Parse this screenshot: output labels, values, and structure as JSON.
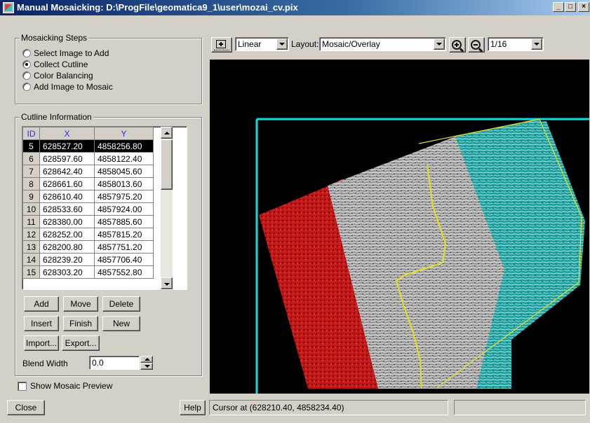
{
  "window": {
    "title": "Manual Mosaicking: D:\\ProgFile\\geomatica9_1\\user\\mozai_cv.pix",
    "controls": {
      "minimize": "_",
      "maximize": "□",
      "close": "×"
    }
  },
  "mosaicking_steps": {
    "label": "Mosaicking Steps",
    "options": [
      "Select Image to Add",
      "Collect Cutline",
      "Color Balancing",
      "Add Image to Mosaic"
    ],
    "selected_index": 1
  },
  "cutline": {
    "label": "Cutline Information",
    "columns": [
      "ID",
      "X",
      "Y"
    ],
    "rows": [
      [
        "5",
        "628527.20",
        "4858256.80"
      ],
      [
        "6",
        "628597.60",
        "4858122.40"
      ],
      [
        "7",
        "628642.40",
        "4858045.60"
      ],
      [
        "8",
        "628661.60",
        "4858013.60"
      ],
      [
        "9",
        "628610.40",
        "4857975.20"
      ],
      [
        "10",
        "628533.60",
        "4857924.00"
      ],
      [
        "11",
        "628380.00",
        "4857885.60"
      ],
      [
        "12",
        "628252.00",
        "4857815.20"
      ],
      [
        "13",
        "628200.80",
        "4857751.20"
      ],
      [
        "14",
        "628239.20",
        "4857706.40"
      ],
      [
        "15",
        "628303.20",
        "4857552.80"
      ]
    ],
    "selected_row": 0,
    "buttons": {
      "add": "Add",
      "move": "Move",
      "delete": "Delete",
      "insert": "Insert",
      "finish": "Finish",
      "new": "New",
      "import": "Import...",
      "export": "Export..."
    },
    "blend_width_label": "Blend Width",
    "blend_width_value": "0.0"
  },
  "show_preview_label": "Show Mosaic Preview",
  "show_preview_checked": false,
  "toolbar": {
    "stretch_value": "Linear",
    "layout_label": "Layout:",
    "layout_value": "Mosaic/Overlay",
    "zoom_value": "1/16"
  },
  "bottom": {
    "close_label": "Close",
    "help_label": "Help",
    "status_text": "Cursor at (628210.40, 4858234.40)"
  },
  "colors": {
    "title_bar": "#0a246a",
    "red_image": "#cc1a1a",
    "cyan_image": "#2ab4b4",
    "boundary_box": "#00e0e0",
    "cutline": "#e8e020"
  }
}
